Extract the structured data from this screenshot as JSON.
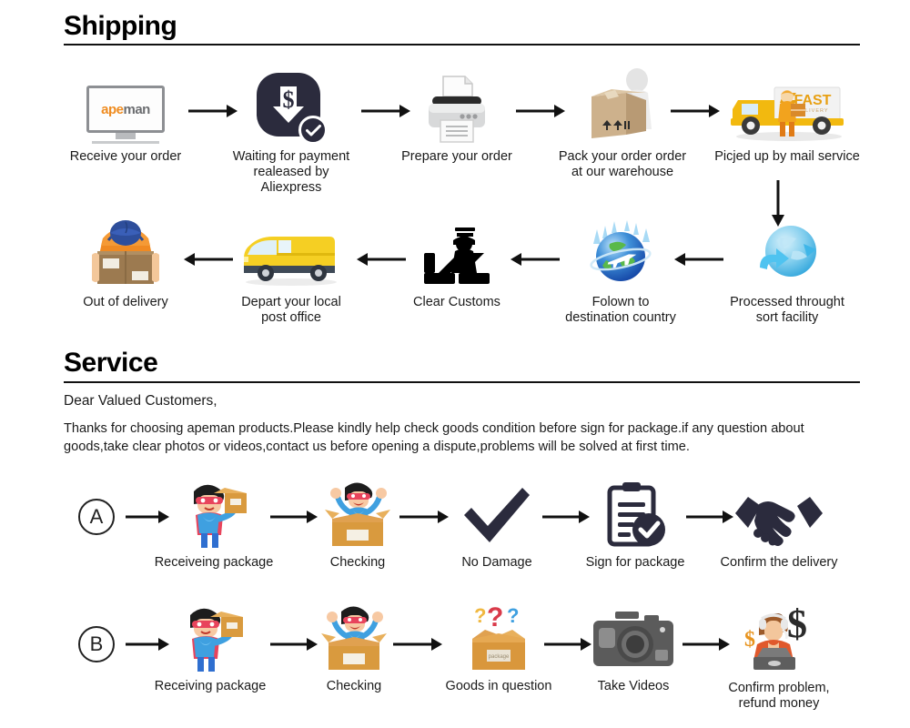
{
  "sections": {
    "shipping_title": "Shipping",
    "service_title": "Service"
  },
  "shipping": {
    "row1": [
      {
        "label": "Receive your order",
        "icon": "monitor-apeman-icon",
        "logo_ape": "ape",
        "logo_man": "man"
      },
      {
        "label": "Waiting for payment\nrealeased by Aliexpress",
        "icon": "payment-dollar-check-icon"
      },
      {
        "label": "Prepare your order",
        "icon": "printer-icon"
      },
      {
        "label": "Pack your order order\nat our warehouse",
        "icon": "packing-box-worker-icon"
      },
      {
        "label": "Picjed up by mail service",
        "icon": "fast-delivery-truck-icon",
        "truck_text": "FAST",
        "truck_subtext": "DELIVERY"
      }
    ],
    "row2": [
      {
        "label": "Out of delivery",
        "icon": "courier-carrying-box-icon"
      },
      {
        "label": "Depart your local\npost office",
        "icon": "yellow-van-icon"
      },
      {
        "label": "Clear Customs",
        "icon": "customs-officer-icon"
      },
      {
        "label": "Folown to\ndestination country",
        "icon": "globe-airplane-icon"
      },
      {
        "label": "Processed throught\nsort facility",
        "icon": "globe-sort-arrow-icon"
      }
    ]
  },
  "service": {
    "greeting": "Dear Valued Customers,",
    "paragraph": "Thanks for choosing apeman products.Please kindly help check goods condition before sign for package.if any question about goods,take clear photos or videos,contact us before opening a dispute,problems will be solved at first time.",
    "rowA": {
      "marker": "A",
      "steps": [
        {
          "label": "Receiveing package",
          "icon": "hero-holding-box-icon"
        },
        {
          "label": "Checking",
          "icon": "hero-in-box-icon"
        },
        {
          "label": "No Damage",
          "icon": "checkmark-icon"
        },
        {
          "label": "Sign for package",
          "icon": "clipboard-check-icon"
        },
        {
          "label": "Confirm the delivery",
          "icon": "handshake-icon"
        }
      ]
    },
    "rowB": {
      "marker": "B",
      "steps": [
        {
          "label": "Receiving package",
          "icon": "hero-holding-box-icon"
        },
        {
          "label": "Checking",
          "icon": "hero-in-box-icon"
        },
        {
          "label": "Goods in question",
          "icon": "box-question-marks-icon"
        },
        {
          "label": "Take Videos",
          "icon": "camera-icon"
        },
        {
          "label": "Confirm problem,\nrefund money",
          "icon": "support-agent-dollar-icon"
        }
      ]
    }
  },
  "colors": {
    "accent_orange": "#ef8c20",
    "dark_navy": "#2b2b3d",
    "truck_yellow": "#f5c518",
    "globe_blue": "#2b7fd4",
    "text": "#1a1a1a"
  }
}
